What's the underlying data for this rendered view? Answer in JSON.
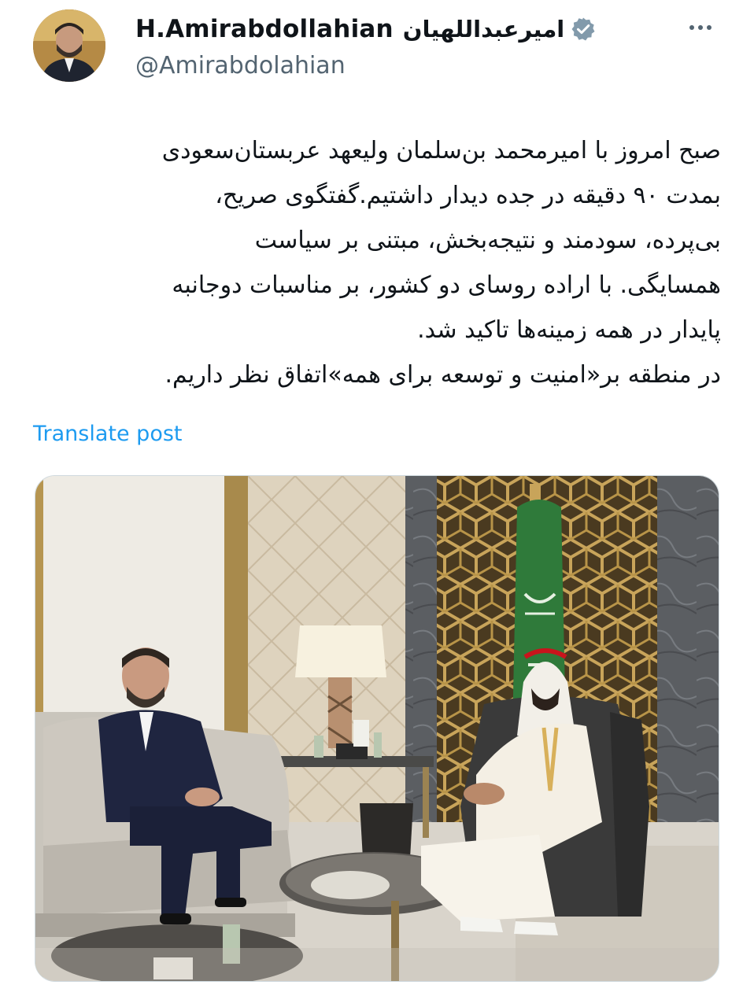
{
  "author": {
    "display_name": "H.Amirabdollahian",
    "persian_name": "امیرعبداللهیان",
    "handle": "@Amirabdolahian",
    "verified_icon": "verified-badge-icon",
    "more_icon": "more-options-icon"
  },
  "tweet": {
    "lines": [
      "صبح امروز با امیرمحمد بن‌سلمان ولیعهد عربستان‌سعودی",
      "بمدت ۹۰ دقیقه در جده دیدار داشتیم.گفتگوی صریح،",
      "بی‌پرده، سودمند و نتیجه‌بخش، مبتنی بر سیاست",
      "همسایگی. با اراده روسای دو کشور، بر مناسبات دوجانبه",
      "پایدار در همه زمینه‌ها تاکید شد.",
      "در منطقه بر«امنیت و توسعه برای همه»اتفاق نظر داریم."
    ],
    "translate_label": "Translate post"
  },
  "colors": {
    "link": "#1d9bf0",
    "verified": "#829aab",
    "text": "#0f1419",
    "secondary": "#536471",
    "flag_green": "#2f7a3a"
  }
}
